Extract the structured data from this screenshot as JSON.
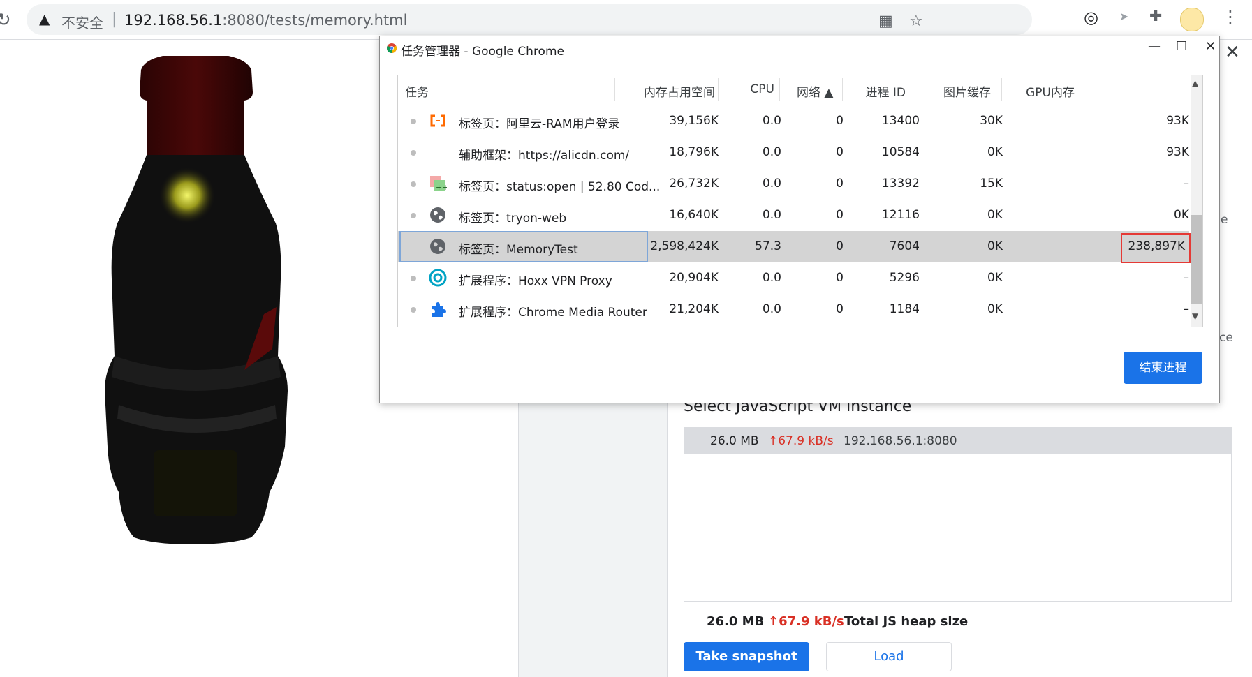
{
  "browser": {
    "insecure_label": "不安全",
    "separator": "|",
    "url_host": "192.168.56.1",
    "url_rest": ":8080/tests/memory.html"
  },
  "task_manager": {
    "title": "任务管理器 - Google Chrome",
    "columns": {
      "task": "任务",
      "memory": "内存占用空间",
      "cpu": "CPU",
      "network": "网络 ▲",
      "pid": "进程 ID",
      "image_cache": "图片缓存",
      "gpu_memory": "GPU内存"
    },
    "rows": [
      {
        "name": "标签页：阿里云-RAM用户登录",
        "icon": "aliyun-icon",
        "memory": "39,156K",
        "cpu": "0.0",
        "network": "0",
        "pid": "13400",
        "image_cache": "30K",
        "gpu": "93K"
      },
      {
        "name": "辅助框架：https://alicdn.com/",
        "icon": "none",
        "memory": "18,796K",
        "cpu": "0.0",
        "network": "0",
        "pid": "10584",
        "image_cache": "0K",
        "gpu": "93K"
      },
      {
        "name": "标签页：status:open | 52.80 Cod...",
        "icon": "gerrit-icon",
        "memory": "26,732K",
        "cpu": "0.0",
        "network": "0",
        "pid": "13392",
        "image_cache": "15K",
        "gpu": "–"
      },
      {
        "name": "标签页：tryon-web",
        "icon": "globe-icon",
        "memory": "16,640K",
        "cpu": "0.0",
        "network": "0",
        "pid": "12116",
        "image_cache": "0K",
        "gpu": "0K"
      },
      {
        "name": "标签页：MemoryTest",
        "icon": "globe-icon",
        "memory": "2,598,424K",
        "cpu": "57.3",
        "network": "0",
        "pid": "7604",
        "image_cache": "0K",
        "gpu": "238,897K"
      },
      {
        "name": "扩展程序：Hoxx VPN Proxy",
        "icon": "hoxx-icon",
        "memory": "20,904K",
        "cpu": "0.0",
        "network": "0",
        "pid": "5296",
        "image_cache": "0K",
        "gpu": "–"
      },
      {
        "name": "扩展程序：Chrome Media Router",
        "icon": "puzzle-icon",
        "memory": "21,204K",
        "cpu": "0.0",
        "network": "0",
        "pid": "1184",
        "image_cache": "0K",
        "gpu": "–"
      }
    ],
    "end_process_label": "结束进程"
  },
  "devtools": {
    "fragment_e": "e",
    "fragment_ce": "ce",
    "vm_title": "Select JavaScript VM instance",
    "vm_row": {
      "size": "26.0 MB",
      "rate": "↑67.9 kB/s",
      "host": "192.168.56.1:8080"
    },
    "summary": {
      "size": "26.0 MB",
      "rate": "↑67.9 kB/s",
      "label": "Total JS heap size"
    },
    "take_snapshot_label": "Take snapshot",
    "load_label": "Load"
  },
  "colors": {
    "accent": "#1a73e8",
    "alert": "#d93025",
    "selected_row": "#d4d4d4"
  }
}
